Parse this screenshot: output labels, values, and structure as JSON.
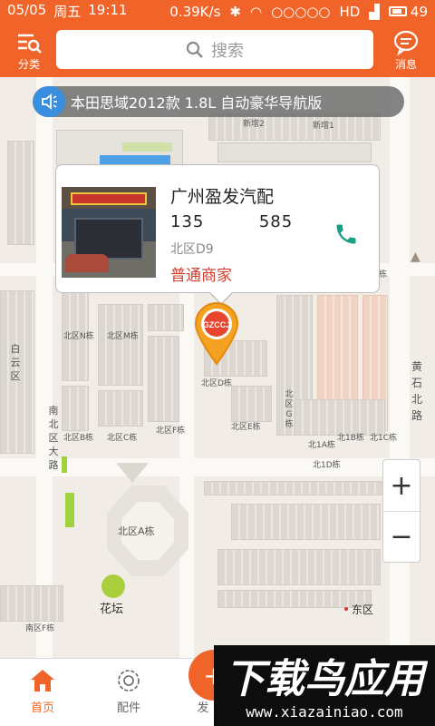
{
  "colors": {
    "accent": "#f0642a",
    "price_red": "#d23c2e",
    "call_green": "#1aa087"
  },
  "status_bar": {
    "date": "05/05",
    "weekday": "周五",
    "time": "19:11",
    "speed": "0.39K/s",
    "signal_type": "HD",
    "battery": "49"
  },
  "header": {
    "category_label": "分类",
    "search_placeholder": "搜索",
    "message_label": "消息"
  },
  "notice": {
    "text": "本田思域2012款 1.8L 自动豪华导航版"
  },
  "shop_card": {
    "name": "广州盈发汽配",
    "phone": "135         585",
    "zone": "北区D9",
    "type": "普通商家"
  },
  "map": {
    "labels": {
      "new2": "新增2",
      "new1": "新增1",
      "bei_n": "北区N栋",
      "bei_m": "北区M栋",
      "bei_d": "北区D栋",
      "bei_b": "北区B栋",
      "bei_c": "北区C栋",
      "bei_f": "北区F栋",
      "bei_e": "北区E栋",
      "bei_g": "北区G栋",
      "bei_1a": "北1A栋",
      "bei_1b": "北1B栋",
      "bei_1c": "北1C栋",
      "bei_1d": "北1D栋",
      "bei_a": "北区A栋",
      "flower": "花坛",
      "east": "东区",
      "south_f": "南区F栋",
      "road_left": "白云区",
      "road_mid": "南北区大路",
      "road_right": "黄石北路",
      "bldg_top_right": "栋"
    },
    "pin_logo": "GZCCJ"
  },
  "zoom": {
    "in": "+",
    "out": "−"
  },
  "tabs": [
    {
      "label": "首页"
    },
    {
      "label": "配件"
    },
    {
      "label": "发"
    }
  ],
  "watermark": {
    "main": "下载鸟应用",
    "url": "www.xiazainiao.com"
  }
}
